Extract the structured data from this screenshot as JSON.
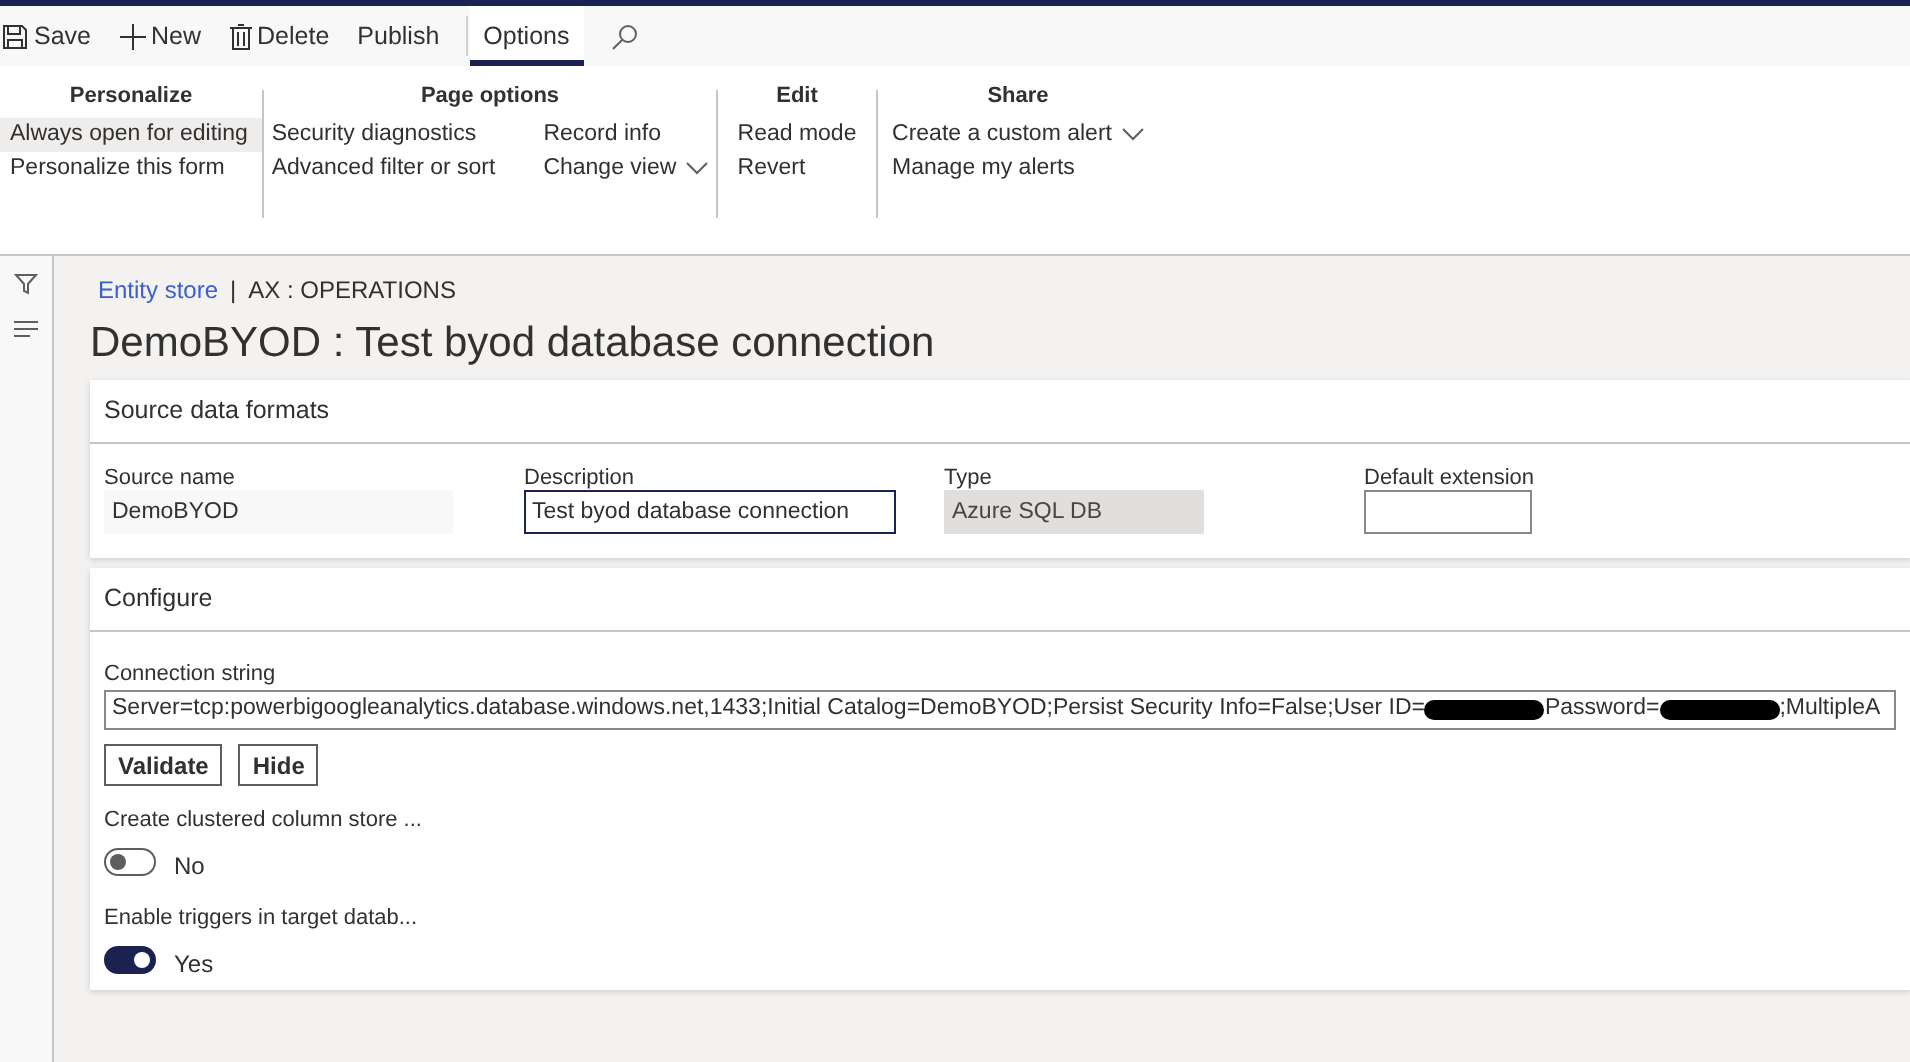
{
  "toolbar": {
    "actions": [
      {
        "kind": "save",
        "label": "Save"
      },
      {
        "kind": "new",
        "label": "New"
      },
      {
        "kind": "delete",
        "label": "Delete"
      },
      {
        "kind": "plain",
        "label": "Publish"
      }
    ],
    "tabs": [
      {
        "label": "Options",
        "selected": true
      }
    ]
  },
  "ribbon": {
    "groups": [
      {
        "title": "Personalize",
        "columns": [
          [
            {
              "label": "Always open for editing",
              "selected": true,
              "dropdown": false
            },
            {
              "label": "Personalize this form",
              "selected": false,
              "dropdown": false
            }
          ]
        ]
      },
      {
        "title": "Page options",
        "columns": [
          [
            {
              "label": "Security diagnostics",
              "selected": false,
              "dropdown": false
            },
            {
              "label": "Advanced filter or sort",
              "selected": false,
              "dropdown": false
            }
          ],
          [
            {
              "label": "Record info",
              "selected": false,
              "dropdown": false
            },
            {
              "label": "Change view",
              "selected": false,
              "dropdown": true
            }
          ]
        ]
      },
      {
        "title": "Edit",
        "columns": [
          [
            {
              "label": "Read mode",
              "selected": false,
              "dropdown": false
            },
            {
              "label": "Revert",
              "selected": false,
              "dropdown": false
            }
          ]
        ]
      },
      {
        "title": "Share",
        "columns": [
          [
            {
              "label": "Create a custom alert",
              "selected": false,
              "dropdown": true
            },
            {
              "label": "Manage my alerts",
              "selected": false,
              "dropdown": false
            }
          ]
        ]
      }
    ]
  },
  "breadcrumb": {
    "link": "Entity store",
    "separator": "|",
    "company": "AX : OPERATIONS"
  },
  "page_title": "DemoBYOD : Test byod database connection",
  "source_data_formats": {
    "title": "Source data formats",
    "fields": [
      {
        "label": "Source name",
        "value": "DemoBYOD",
        "kind": "readonly"
      },
      {
        "label": "Description",
        "value": "Test byod database connection",
        "kind": "focused"
      },
      {
        "label": "Type",
        "value": "Azure SQL DB",
        "kind": "disabled"
      },
      {
        "label": "Default extension",
        "kind": "input"
      }
    ]
  },
  "configure": {
    "title": "Configure",
    "connection_label": "Connection string",
    "connection_parts": [
      {
        "kind": "text",
        "text": "Server=tcp:powerbigoogleanalytics.database.windows.net,1433;Initial Catalog=DemoBYOD;Persist Security Info=False;User ID="
      },
      {
        "kind": "redacted"
      },
      {
        "kind": "text",
        "text": "Password="
      },
      {
        "kind": "redacted"
      },
      {
        "kind": "text",
        "text": ";MultipleA"
      }
    ],
    "buttons": [
      "Validate",
      "Hide"
    ],
    "toggles": [
      {
        "label": "Create clustered column store ...",
        "on": false,
        "state_text": "No"
      },
      {
        "label": "Enable triggers in target datab...",
        "on": true,
        "state_text": "Yes"
      }
    ]
  }
}
